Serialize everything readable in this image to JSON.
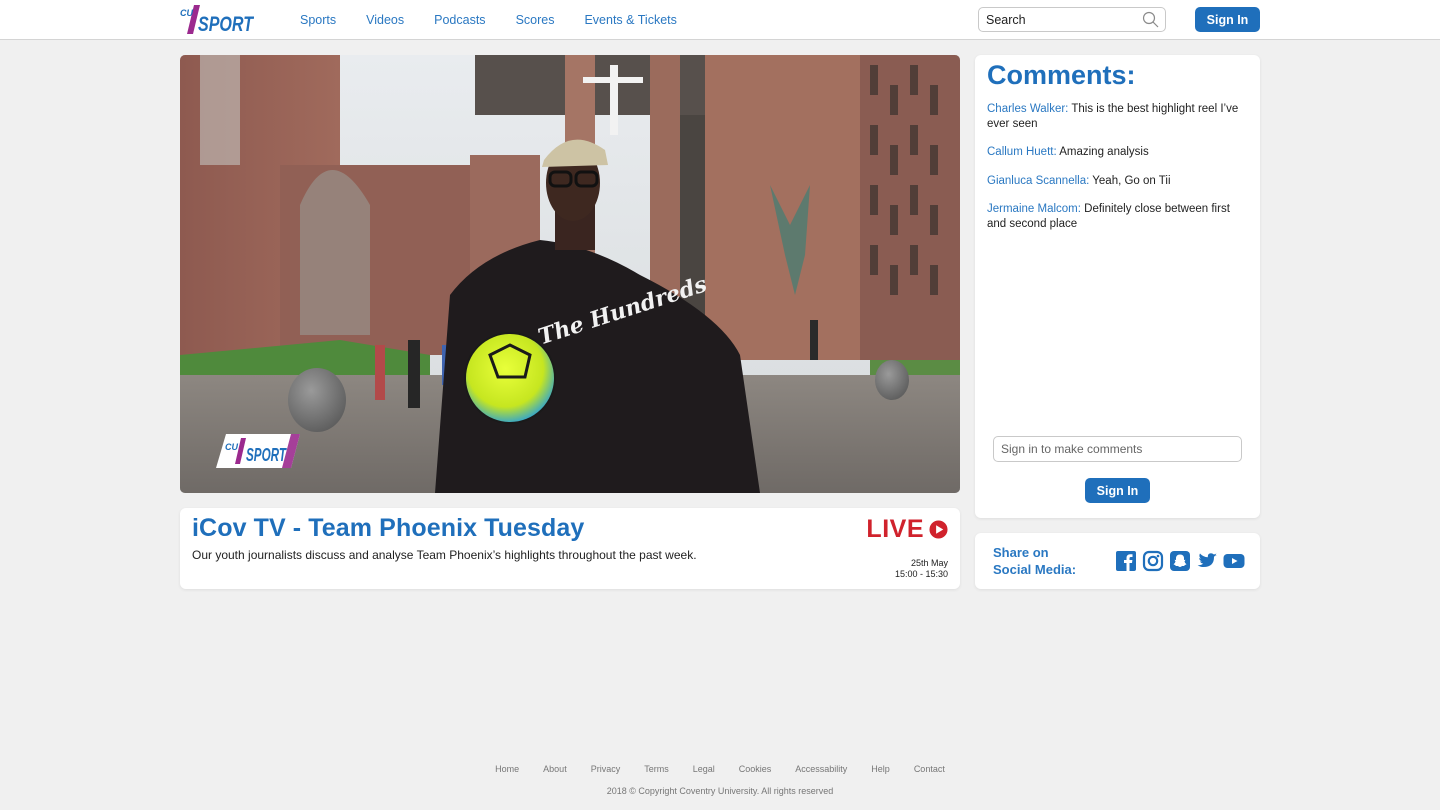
{
  "header": {
    "logo_text_small": "CU",
    "logo_text_main": "SPORT",
    "nav": [
      {
        "label": "Sports"
      },
      {
        "label": "Videos"
      },
      {
        "label": "Podcasts"
      },
      {
        "label": "Scores"
      },
      {
        "label": "Events & Tickets"
      }
    ],
    "search_placeholder": "Search",
    "sign_in_label": "Sign In"
  },
  "video": {
    "watermark_small": "CU",
    "watermark_main": "SPORT",
    "hoodie_text": "The Hundreds"
  },
  "program": {
    "title": "iCov TV - Team Phoenix Tuesday",
    "description": "Our youth journalists discuss and analyse Team Phoenix’s highlights throughout the past week.",
    "live_label": "LIVE",
    "date": "25th May",
    "time": "15:00 - 15:30"
  },
  "comments": {
    "heading": "Comments:",
    "items": [
      {
        "author": "Charles Walker:",
        "text": "This is the best highlight reel I’ve ever seen"
      },
      {
        "author": "Callum Huett:",
        "text": "Amazing analysis"
      },
      {
        "author": "Gianluca Scannella:",
        "text": "Yeah, Go on Tii"
      },
      {
        "author": "Jermaine Malcom:",
        "text": "Definitely close between first and second place"
      }
    ],
    "input_placeholder": "Sign in to make comments",
    "sign_in_label": "Sign In"
  },
  "social": {
    "label_line1": "Share on",
    "label_line2": "Social Media:",
    "icons": [
      "facebook-icon",
      "instagram-icon",
      "snapchat-icon",
      "twitter-icon",
      "youtube-icon"
    ]
  },
  "footer": {
    "links": [
      {
        "label": "Home"
      },
      {
        "label": "About"
      },
      {
        "label": "Privacy"
      },
      {
        "label": "Terms"
      },
      {
        "label": "Legal"
      },
      {
        "label": "Cookies"
      },
      {
        "label": "Accessability"
      },
      {
        "label": "Help"
      },
      {
        "label": "Contact"
      }
    ],
    "copyright": "2018 © Copyright Coventry University. All rights reserved"
  },
  "colors": {
    "brand_blue": "#1f6fbb",
    "link_blue": "#2a78c2",
    "live_red": "#d0222c",
    "logo_purple": "#9b2a8e"
  }
}
